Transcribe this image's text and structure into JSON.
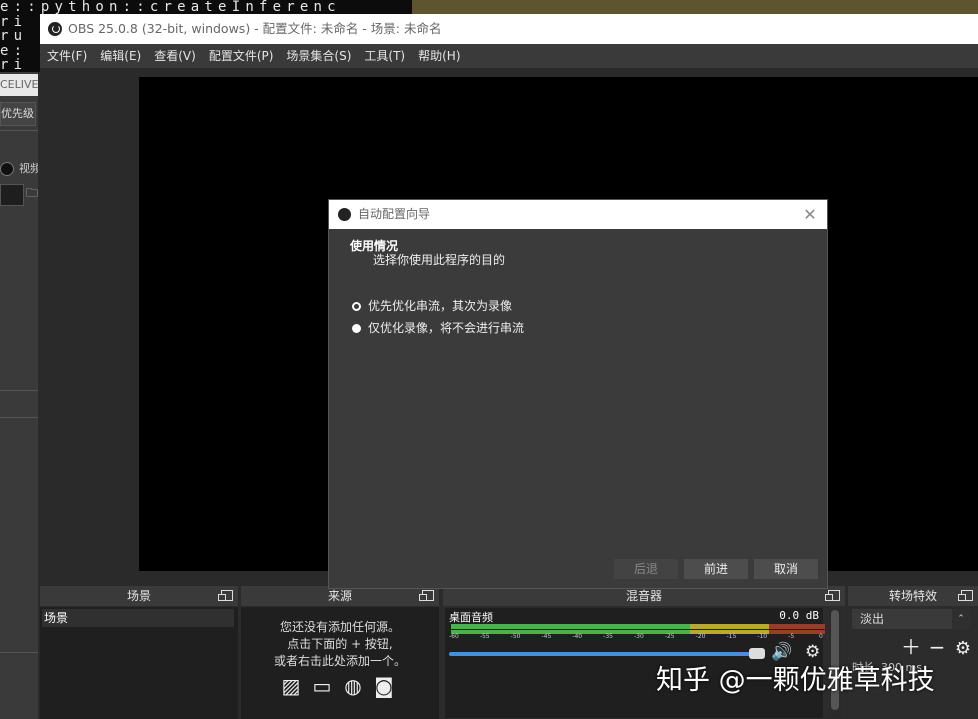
{
  "background": {
    "terminal_lines": [
      "e::python::createInferenc",
      "ri",
      "ru",
      "e:",
      "ri"
    ],
    "left_app": {
      "tab_text": "CELIVE",
      "priority_label": "优先级",
      "video_label": "视频"
    }
  },
  "window": {
    "title": "OBS 25.0.8 (32-bit, windows) - 配置文件: 未命名 - 场景: 未命名"
  },
  "menu": [
    "文件(F)",
    "编辑(E)",
    "查看(V)",
    "配置文件(P)",
    "场景集合(S)",
    "工具(T)",
    "帮助(H)"
  ],
  "dialog": {
    "title": "自动配置向导",
    "close_glyph": "✕",
    "section_title": "使用情况",
    "section_subtitle": "选择你使用此程序的目的",
    "options": [
      {
        "label": "优先优化串流，其次为录像",
        "selected": true
      },
      {
        "label": "仅优化录像，将不会进行串流",
        "selected": false
      }
    ],
    "buttons": {
      "back": "后退",
      "next": "前进",
      "cancel": "取消"
    }
  },
  "docks": {
    "scenes": {
      "title": "场景",
      "items": [
        "场景"
      ]
    },
    "sources": {
      "title": "来源",
      "hint_lines": [
        "您还没有添加任何源。",
        "点击下面的 + 按钮,",
        "或者右击此处添加一个。"
      ],
      "icons": [
        "image-icon",
        "display-icon",
        "globe-icon",
        "camera-icon"
      ]
    },
    "mixer": {
      "title": "混音器",
      "channel": "桌面音频",
      "db": "0.0 dB",
      "ticks": [
        "-60",
        "-55",
        "-50",
        "-45",
        "-40",
        "-35",
        "-30",
        "-25",
        "-20",
        "-15",
        "-10",
        "-5",
        "0"
      ],
      "volume": 0.92
    },
    "transitions": {
      "title": "转场特效",
      "selected": "淡出",
      "duration_label": "时长",
      "duration_value": "300 ms"
    }
  },
  "watermark": "知乎 @一颗优雅草科技",
  "colors": {
    "accent": "#4a90d9",
    "meter_green": "#4caf50",
    "meter_yellow": "#d9c230",
    "meter_red": "#c0392b"
  }
}
